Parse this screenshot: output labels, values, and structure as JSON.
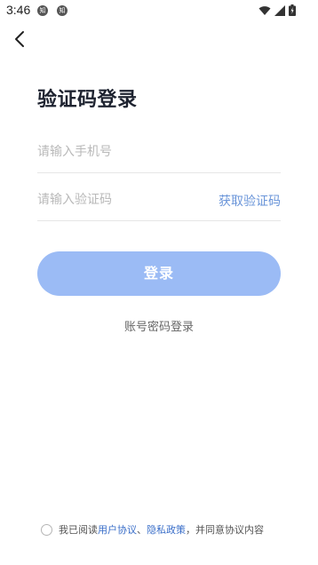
{
  "status_bar": {
    "time": "3:46",
    "notifications": [
      "知",
      "知"
    ]
  },
  "title": "验证码登录",
  "phone_field": {
    "placeholder": "请输入手机号",
    "value": ""
  },
  "code_field": {
    "placeholder": "请输入验证码",
    "value": ""
  },
  "get_code_label": "获取验证码",
  "login_button_label": "登录",
  "password_login_label": "账号密码登录",
  "agreement": {
    "prefix": "我已阅读",
    "user_agreement": "用户协议",
    "separator": "、",
    "privacy_policy": "隐私政策",
    "suffix": "，并同意协议内容"
  },
  "colors": {
    "accent": "#9bbbf5",
    "link": "#3b6fc9",
    "get_code": "#6a95d9",
    "title": "#1e2330"
  }
}
